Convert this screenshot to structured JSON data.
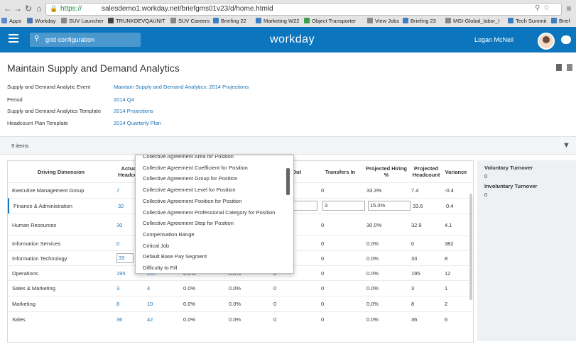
{
  "browser": {
    "url_scheme": "https://",
    "url_rest": "salesdemo1.workday.net/briefgms01v23/d/home.htmld",
    "bookmarks": [
      "Apps",
      "Workday",
      "SUV Launcher",
      "TRUNKDEVQAUNIT",
      "SUV Careers",
      "Briefing 22",
      "Marketing W22",
      "Object Transporter",
      "View Jobs",
      "Briefing 23",
      "MGI-Global_labor_I",
      "Tech Summit",
      "Brief"
    ]
  },
  "header": {
    "search_value": "grid configuration",
    "logo": "workday",
    "user_name": "Logan McNeil"
  },
  "page": {
    "title": "Maintain Supply and Demand Analytics",
    "fields": [
      {
        "label": "Supply and Demand Analytic Event",
        "value": "Maintain Supply and Demand Analytics: 2014 Projections"
      },
      {
        "label": "Period",
        "value": "2014 Q4"
      },
      {
        "label": "Supply and Demand Analytics Template",
        "value": "2014 Projections"
      },
      {
        "label": "Headcount Plan Template",
        "value": "2014 Quarterly Plan"
      }
    ],
    "items_count": "9 items"
  },
  "grid": {
    "headers": {
      "driving_dimension": "Driving Dimension",
      "actual_headcount": "Actual Headcou",
      "transfers_out": "ers Out",
      "transfers_in": "Transfers In",
      "projected_hiring": "Projected Hiring %",
      "projected_headcount": "Projected Headcount",
      "variance": "Variance"
    },
    "rows": [
      {
        "dim": "Executive Management Group",
        "actual": "7",
        "c2": "",
        "c3": "",
        "c4": "",
        "tout": "",
        "tin": "0",
        "hiring": "33.3%",
        "proj": "7.4",
        "var": "-0.4"
      },
      {
        "dim": "Finance & Administration",
        "actual": "32",
        "c2": "",
        "c3": "",
        "c4": "",
        "tout": "",
        "tin": "3",
        "hiring": "15.0%",
        "proj": "33.6",
        "var": "0.4"
      },
      {
        "dim": "Human Resources",
        "actual": "30",
        "c2": "",
        "c3": "",
        "c4": "",
        "tout": "",
        "tin": "0",
        "hiring": "30.0%",
        "proj": "32.9",
        "var": "4.1"
      },
      {
        "dim": "Information Services",
        "actual": "0",
        "c2": "",
        "c3": "",
        "c4": "",
        "tout": "",
        "tin": "0",
        "hiring": "0.0%",
        "proj": "0",
        "var": "382"
      },
      {
        "dim": "Information Technology",
        "actual": "33",
        "c2": "",
        "c3": "",
        "c4": "",
        "tout": "",
        "tin": "0",
        "hiring": "0.0%",
        "proj": "33",
        "var": "8"
      },
      {
        "dim": "Operations",
        "actual": "195",
        "c2": "207",
        "c3": "0.0%",
        "c4": "0.0%",
        "tout": "0",
        "tin": "0",
        "hiring": "0.0%",
        "proj": "195",
        "var": "12"
      },
      {
        "dim": "Sales & Marketing",
        "actual": "3",
        "c2": "4",
        "c3": "0.0%",
        "c4": "0.0%",
        "tout": "0",
        "tin": "0",
        "hiring": "0.0%",
        "proj": "3",
        "var": "1"
      },
      {
        "dim": "Marketing",
        "actual": "8",
        "c2": "10",
        "c3": "0.0%",
        "c4": "0.0%",
        "tout": "0",
        "tin": "0",
        "hiring": "0.0%",
        "proj": "8",
        "var": "2"
      },
      {
        "dim": "Sales",
        "actual": "36",
        "c2": "42",
        "c3": "0.0%",
        "c4": "0.0%",
        "tout": "0",
        "tin": "0",
        "hiring": "0.0%",
        "proj": "36",
        "var": "6"
      }
    ]
  },
  "dropdown": {
    "options": [
      "Collective Agreement Area for Position",
      "Collective Agreement Coefficient for Position",
      "Collective Agreement Group for Position",
      "Collective Agreement Level for Position",
      "Collective Agreement Position for Position",
      "Collective Agreement Professional Category for Position",
      "Collective Agreement Step for Position",
      "Compensation Range",
      "Critical Job",
      "Default Base Pay Segment",
      "Difficulty to Fill"
    ]
  },
  "right_panel": {
    "voluntary_label": "Voluntary Turnover",
    "voluntary_value": "0",
    "involuntary_label": "Involuntary Turnover",
    "involuntary_value": "0"
  }
}
